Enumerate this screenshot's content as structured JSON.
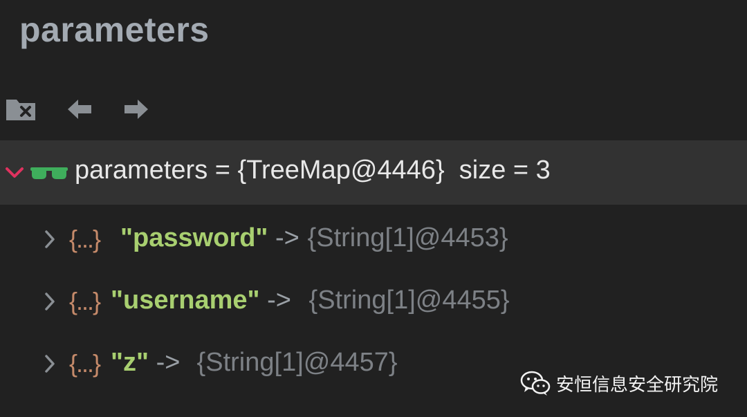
{
  "panel": {
    "title": "parameters"
  },
  "toolbar": {
    "icons": [
      "folder-close-icon",
      "arrow-left-icon",
      "arrow-right-icon"
    ]
  },
  "tree": {
    "root": {
      "label": "parameters = {TreeMap@4446}  size = 3",
      "expanded": true
    },
    "entries": [
      {
        "brace": "{...}",
        "key": "\"password\"",
        "arrow": " ->",
        "value": " {String[1]@4453}"
      },
      {
        "brace": "{...}",
        "key": "\"username\"",
        "arrow": " ->",
        "value": " {String[1]@4455}"
      },
      {
        "brace": "{...}",
        "key": "\"z\"",
        "arrow": " ->",
        "value": " {String[1]@4457}"
      }
    ]
  },
  "watermark": {
    "text": "安恒信息安全研究院"
  },
  "colors": {
    "background": "#212121",
    "selected_row": "#323232",
    "key_green": "#a8cf70",
    "brace_orange": "#c58a6a",
    "chevron_red": "#e0325f",
    "glasses_green": "#3fae5c"
  }
}
